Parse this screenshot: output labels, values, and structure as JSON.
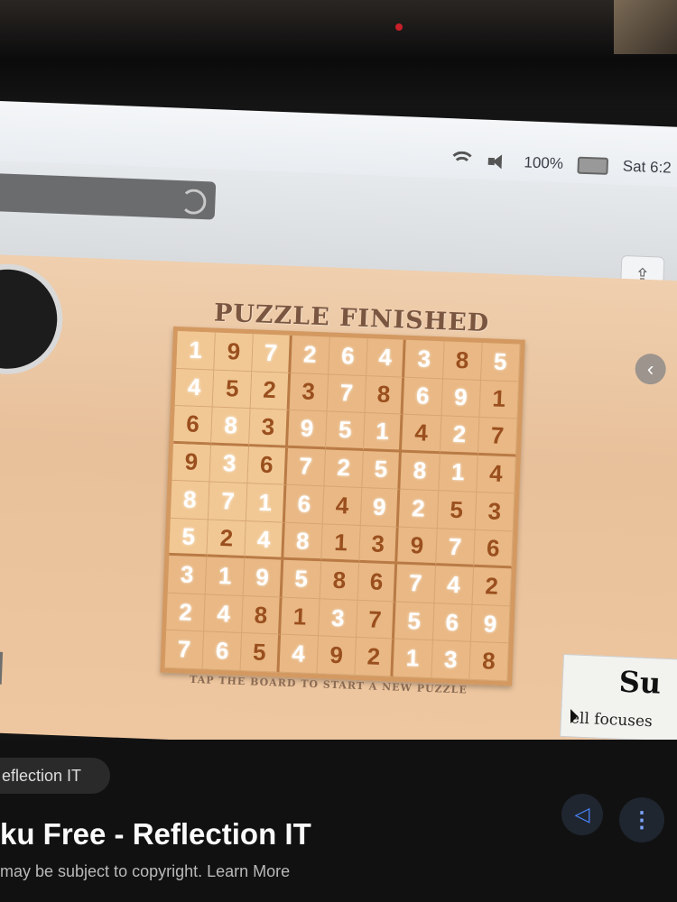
{
  "menubar": {
    "battery_percent": "100%",
    "clock": "Sat 6:2"
  },
  "game": {
    "title": "PUZZLE FINISHED",
    "caption": "TAP THE BOARD TO START A NEW PUZZLE",
    "grid": [
      [
        "1",
        "9",
        "7",
        "2",
        "6",
        "4",
        "3",
        "8",
        "5"
      ],
      [
        "4",
        "5",
        "2",
        "3",
        "7",
        "8",
        "6",
        "9",
        "1"
      ],
      [
        "6",
        "8",
        "3",
        "9",
        "5",
        "1",
        "4",
        "2",
        "7"
      ],
      [
        "9",
        "3",
        "6",
        "7",
        "2",
        "5",
        "8",
        "1",
        "4"
      ],
      [
        "8",
        "7",
        "1",
        "6",
        "4",
        "9",
        "2",
        "5",
        "3"
      ],
      [
        "5",
        "2",
        "4",
        "8",
        "1",
        "3",
        "9",
        "7",
        "6"
      ],
      [
        "3",
        "1",
        "9",
        "5",
        "8",
        "6",
        "7",
        "4",
        "2"
      ],
      [
        "2",
        "4",
        "8",
        "1",
        "3",
        "7",
        "5",
        "6",
        "9"
      ],
      [
        "7",
        "6",
        "5",
        "4",
        "9",
        "2",
        "1",
        "3",
        "8"
      ]
    ],
    "given_mask": [
      [
        1,
        0,
        1,
        1,
        1,
        1,
        1,
        0,
        1
      ],
      [
        1,
        0,
        0,
        0,
        1,
        0,
        1,
        1,
        0
      ],
      [
        0,
        1,
        0,
        1,
        1,
        1,
        0,
        1,
        0
      ],
      [
        0,
        1,
        0,
        1,
        1,
        1,
        1,
        1,
        0
      ],
      [
        1,
        1,
        1,
        1,
        0,
        1,
        1,
        0,
        0
      ],
      [
        1,
        0,
        1,
        1,
        0,
        0,
        0,
        1,
        0
      ],
      [
        1,
        1,
        1,
        1,
        0,
        0,
        1,
        1,
        0
      ],
      [
        1,
        1,
        0,
        0,
        1,
        0,
        1,
        1,
        1
      ],
      [
        1,
        1,
        0,
        1,
        0,
        0,
        1,
        1,
        0
      ]
    ]
  },
  "ad": {
    "masthead": "Su",
    "text": "ell focuses"
  },
  "video": {
    "channel": "eflection IT",
    "title": "ku Free - Reflection IT",
    "copyright": "may be subject to copyright. Learn More"
  },
  "colors": {
    "given": "#ffffff",
    "solved": "#9a4f1e",
    "wood": "#e9b884"
  }
}
